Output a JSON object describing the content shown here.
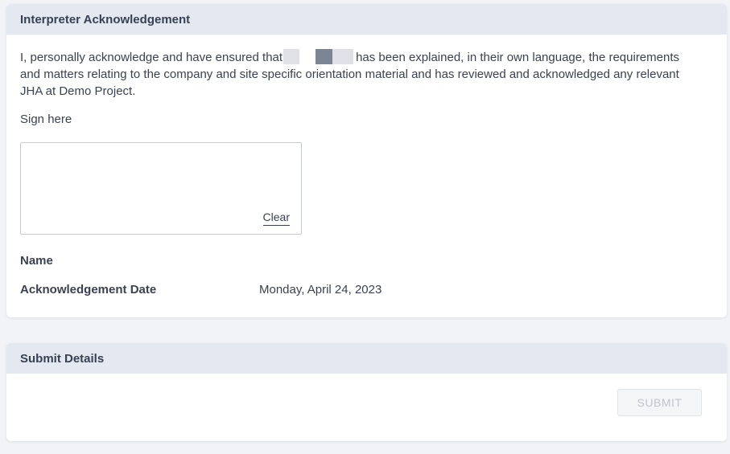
{
  "interpreter_card": {
    "title": "Interpreter Acknowledgement",
    "text_before": "I, personally acknowledge and have ensured that",
    "text_after": "has been explained, in their own language, the requirements and matters relating to the company and site specific orientation material and has reviewed and acknowledged any relevant JHA at Demo Project.",
    "sign_label": "Sign here",
    "clear_label": "Clear",
    "name_label": "Name",
    "name_value": "",
    "date_label": "Acknowledgement Date",
    "date_value": "Monday, April 24, 2023"
  },
  "submit_card": {
    "title": "Submit Details",
    "submit_label": "SUBMIT"
  },
  "colors": {
    "header_bg": "#e3e8f1",
    "text": "#3b4150",
    "redaction_light": "#dfe1e6",
    "redaction_dark": "#7c8596",
    "submit_disabled_text": "#c0c4cc"
  }
}
